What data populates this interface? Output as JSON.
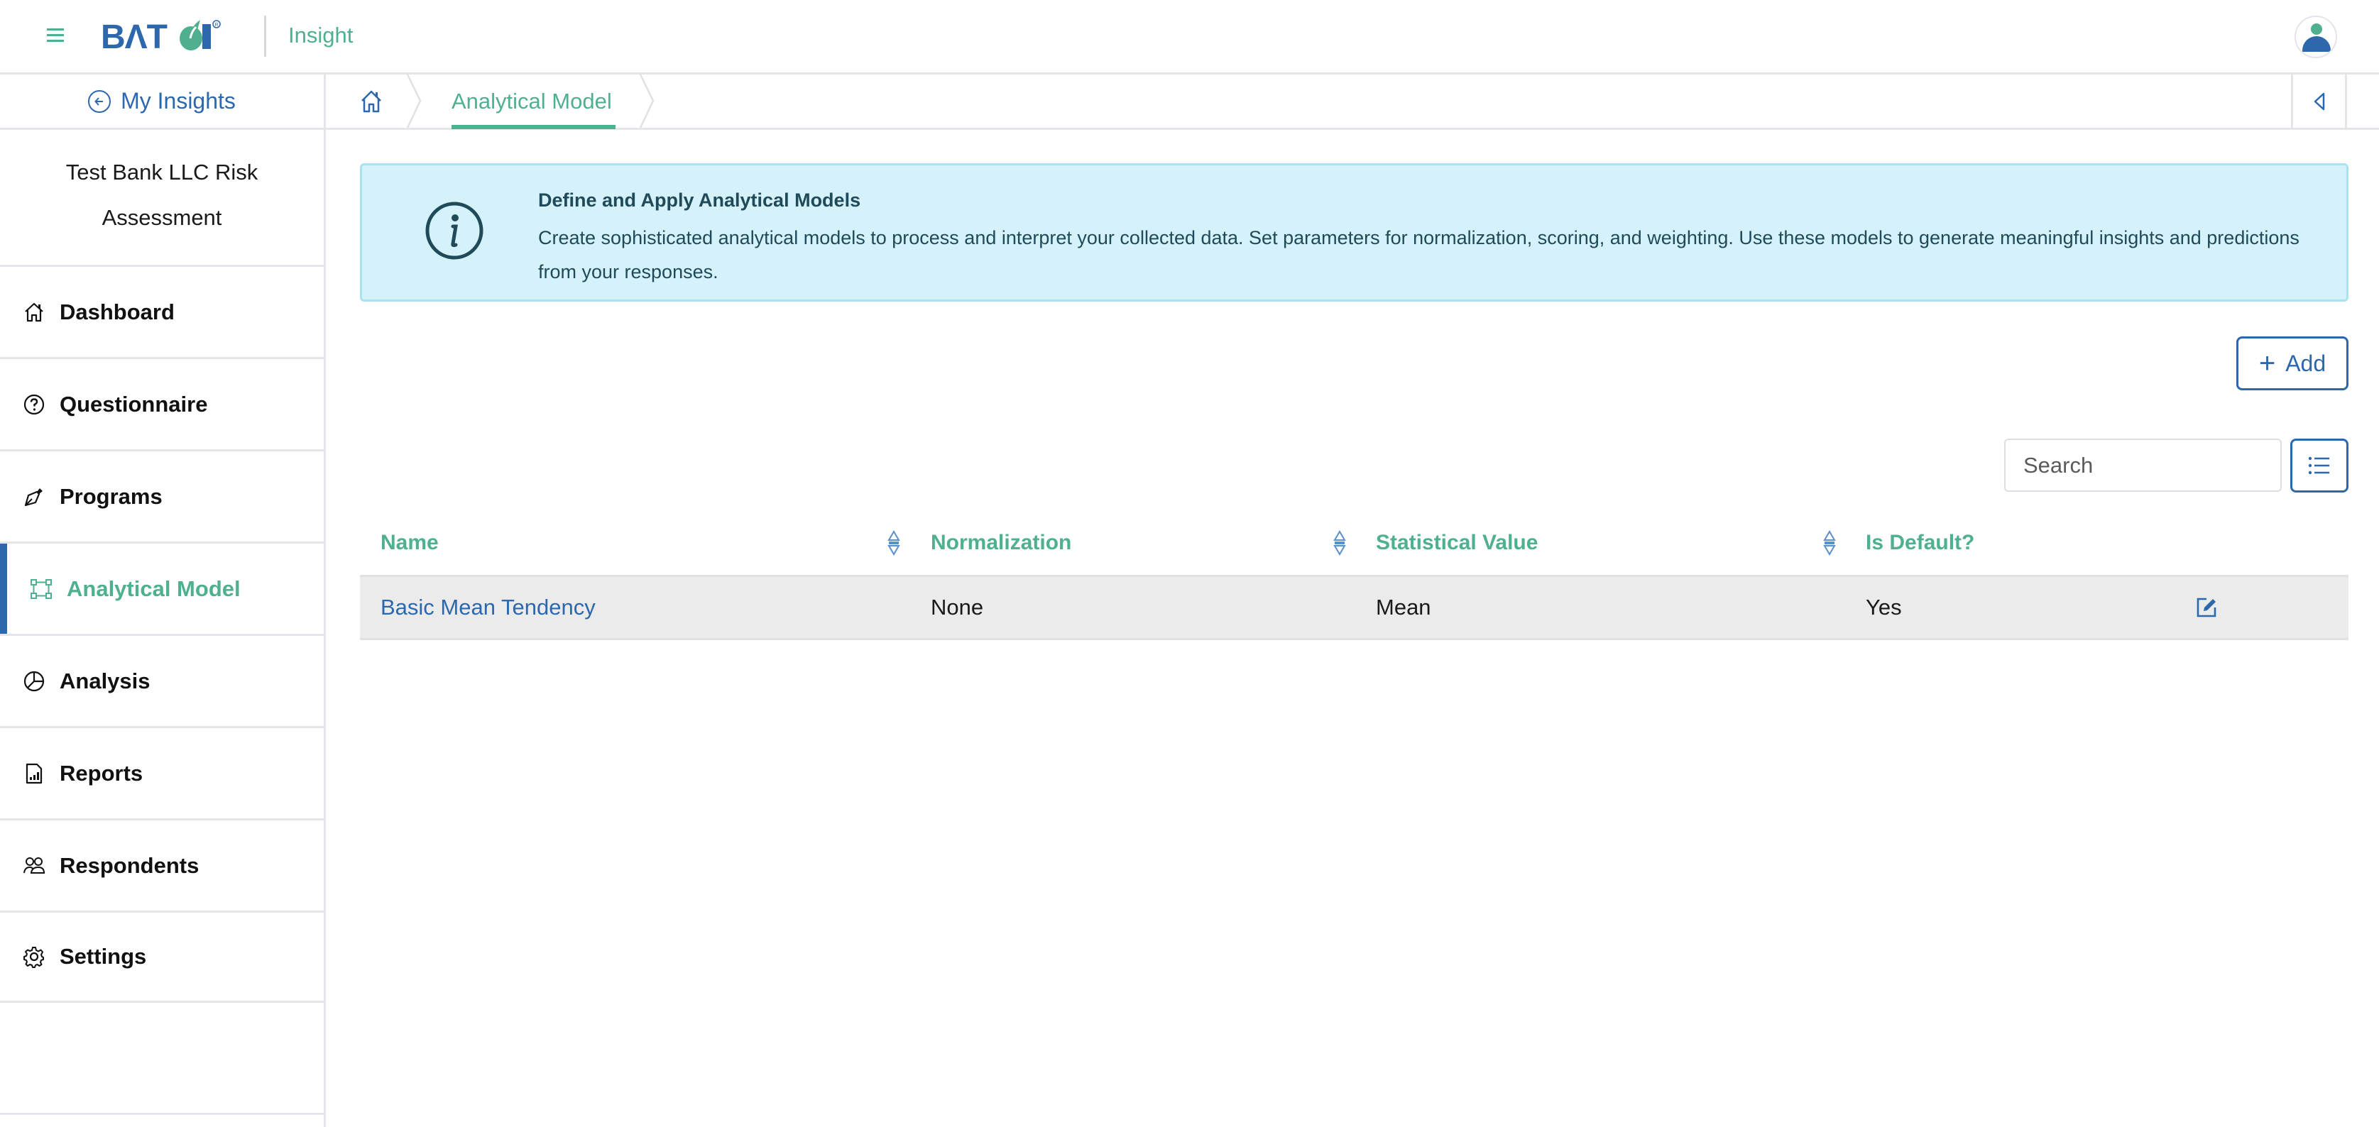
{
  "header": {
    "logo_text": "BATOI",
    "app_name": "Insight",
    "menu_icon": "hamburger-menu-icon",
    "avatar_icon": "user-avatar-icon"
  },
  "breadcrumb": {
    "back_label": "My Insights",
    "home_icon": "home-icon",
    "items": [
      {
        "label": "Analytical Model",
        "active": true
      }
    ],
    "collapse_icon": "triangle-left-icon"
  },
  "sidebar": {
    "project_title_line1": "Test Bank LLC Risk",
    "project_title_line2": "Assessment",
    "items": [
      {
        "label": "Dashboard",
        "icon": "home-icon",
        "active": false
      },
      {
        "label": "Questionnaire",
        "icon": "question-circle-icon",
        "active": false
      },
      {
        "label": "Programs",
        "icon": "pen-nib-icon",
        "active": false
      },
      {
        "label": "Analytical Model",
        "icon": "bounding-box-icon",
        "active": true
      },
      {
        "label": "Analysis",
        "icon": "pie-chart-icon",
        "active": false
      },
      {
        "label": "Reports",
        "icon": "file-bar-chart-icon",
        "active": false
      },
      {
        "label": "Respondents",
        "icon": "people-icon",
        "active": false
      },
      {
        "label": "Settings",
        "icon": "gear-icon",
        "active": false
      }
    ]
  },
  "info": {
    "icon": "info-circle-icon",
    "title": "Define and Apply Analytical Models",
    "text": "Create sophisticated analytical models to process and interpret your collected data. Set parameters for normalization, scoring, and weighting. Use these models to generate meaningful insights and predictions from your responses."
  },
  "toolbar": {
    "add_label": "Add",
    "search_placeholder": "Search",
    "search_value": "",
    "column_toggle_icon": "list-icon"
  },
  "table": {
    "columns": [
      "Name",
      "Normalization",
      "Statistical Value",
      "Is Default?"
    ],
    "rows": [
      {
        "name": "Basic Mean Tendency",
        "normalization": "None",
        "statistical_value": "Mean",
        "is_default": "Yes",
        "action_icon": "edit-icon"
      }
    ]
  },
  "colors": {
    "brand_blue": "#2d68ad",
    "brand_green": "#4fb08f",
    "info_bg": "#d5f1fa",
    "row_bg": "#ebebeb"
  }
}
